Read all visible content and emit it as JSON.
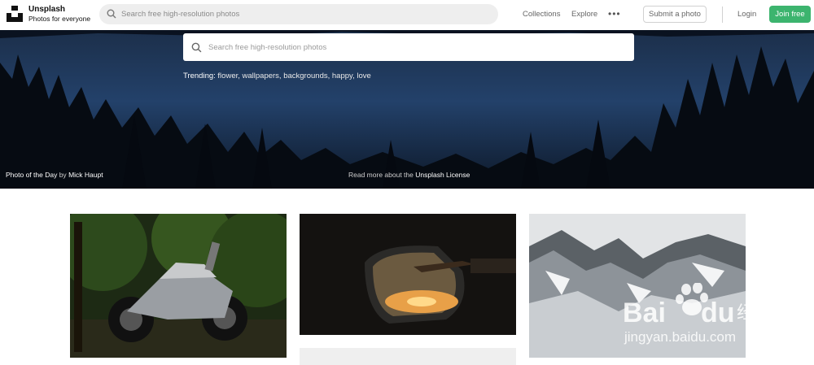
{
  "app": {
    "name": "Unsplash",
    "tagline": "Photos for everyone"
  },
  "nav": {
    "search_placeholder": "Search free high-resolution photos",
    "collections": "Collections",
    "explore": "Explore",
    "more": "•••",
    "submit": "Submit a photo",
    "login": "Login",
    "join": "Join free"
  },
  "hero": {
    "search_placeholder": "Search free high-resolution photos",
    "trending_label": "Trending:",
    "trending_items": "flower, wallpapers, backgrounds, happy, love",
    "photo_of_day": "Photo of the Day",
    "by": "by",
    "author": "Mick Haupt",
    "license_prefix": "Read more about the",
    "license_link": "Unsplash License"
  },
  "colors": {
    "accent": "#3cb46e",
    "hero_dark": "#0f1a2b"
  },
  "icons": {
    "search": "search-icon",
    "logo": "unsplash-logo-icon"
  },
  "watermark": {
    "brand": "Baidu经验",
    "url": "jingyan.baidu.com"
  }
}
